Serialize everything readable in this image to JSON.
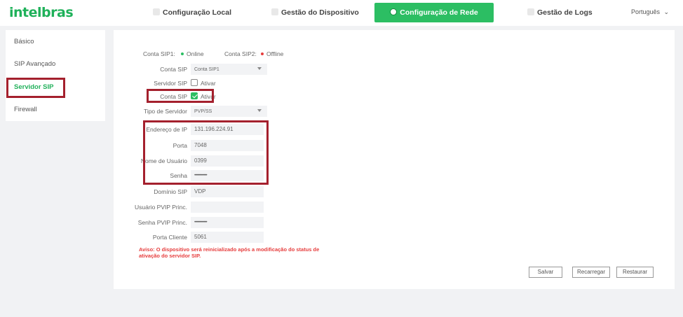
{
  "brand": {
    "logo": "intelbras",
    "accent": "#2cbe63",
    "highlight": "#a4202d"
  },
  "tabs": [
    {
      "label": "Configuração Local"
    },
    {
      "label": "Gestão do Dispositivo"
    },
    {
      "label": "Configuração de Rede",
      "active": true
    },
    {
      "label": "Gestão de Logs"
    }
  ],
  "language": "Português",
  "sidebar": {
    "items": [
      {
        "label": "Básico"
      },
      {
        "label": "SIP Avançado"
      },
      {
        "label": "Servidor SIP",
        "active": true
      },
      {
        "label": "Firewall"
      }
    ]
  },
  "form": {
    "status": {
      "sip1_label": "Conta SIP1:",
      "sip1_value": "Online",
      "sip1_color": "#2cbe63",
      "sip2_label": "Conta SIP2:",
      "sip2_value": "Offline",
      "sip2_color": "#e63d3d"
    },
    "conta_sip": {
      "label": "Conta SIP",
      "value": "Conta SIP1"
    },
    "servidor_sip": {
      "label": "Servidor SIP",
      "option": "Ativar",
      "checked": false
    },
    "conta_sip_enable": {
      "label": "Conta SIP",
      "option": "Ativar",
      "checked": true
    },
    "tipo_servidor": {
      "label": "Tipo de Servidor",
      "value": "PVP/SS"
    },
    "endereco_ip": {
      "label": "Endereço de IP",
      "value": "131.196.224.91"
    },
    "porta": {
      "label": "Porta",
      "value": "7048"
    },
    "nome_usuario": {
      "label": "Nome de Usuário",
      "value": "0399"
    },
    "senha": {
      "label": "Senha",
      "value": "••••••••••••••••"
    },
    "dominio_sip": {
      "label": "Domínio SIP",
      "value": "VDP"
    },
    "usuario_pvip": {
      "label": "Usuário PVIP Princ.",
      "value": ""
    },
    "senha_pvip": {
      "label": "Senha PVIP Princ.",
      "value": "••••••••••••••••"
    },
    "porta_cliente": {
      "label": "Porta Cliente",
      "value": "5061"
    },
    "warning": "Aviso: O dispositivo será reinicializado após a modificação do status de ativação do servidor SIP."
  },
  "buttons": {
    "save": "Salvar",
    "reload": "Recarregar",
    "restore": "Restaurar"
  }
}
